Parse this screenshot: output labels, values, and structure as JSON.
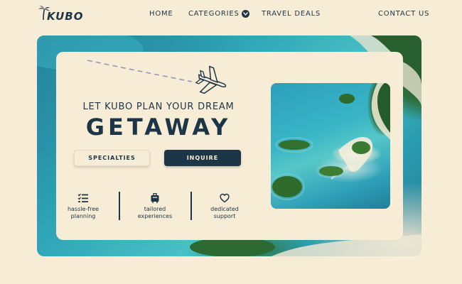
{
  "nav": {
    "logo_text": "KUBO",
    "items": [
      "HOME",
      "CATEGORIES",
      "TRAVEL DEALS"
    ],
    "contact": "CONTACT US",
    "logo_icon": "palm-tree-icon",
    "categories_icon": "chevron-down-icon"
  },
  "hero": {
    "tagline": "LET KUBO PLAN YOUR DREAM",
    "headline": "GETAWAY",
    "buttons": {
      "specialties": "SPECIALTIES",
      "inquire": "INQUIRE"
    },
    "plane_icon": "airplane-icon",
    "features": [
      {
        "icon": "checklist-icon",
        "line1": "hassle-free",
        "line2": "planning"
      },
      {
        "icon": "luggage-icon",
        "line1": "tailored",
        "line2": "experiences"
      },
      {
        "icon": "heart-icon",
        "line1": "dedicated",
        "line2": "support"
      }
    ]
  },
  "colors": {
    "background": "#f7ecd6",
    "navy": "#1c3547",
    "lagoon": "#2fa6b8"
  }
}
